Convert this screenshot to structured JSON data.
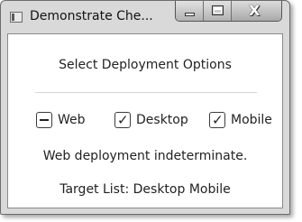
{
  "window": {
    "title": "Demonstrate Che...",
    "controls": {
      "minimize": "minimize-icon",
      "maximize": "maximize-icon",
      "close": "close-icon",
      "close_glyph": "X"
    }
  },
  "main": {
    "heading": "Select Deployment Options",
    "options": [
      {
        "label": "Web",
        "state": "indeterminate"
      },
      {
        "label": "Desktop",
        "state": "checked",
        "mark": "✓"
      },
      {
        "label": "Mobile",
        "state": "checked",
        "mark": "✓"
      }
    ],
    "status_text": "Web deployment indeterminate.",
    "target_list_text": "Target List: Desktop Mobile"
  },
  "colors": {
    "window_frame": "#d9d9d9",
    "client_background": "#ffffff",
    "text": "#222222"
  }
}
